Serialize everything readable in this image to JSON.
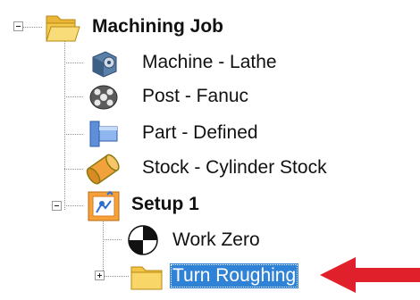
{
  "tree": {
    "root": {
      "label": "Machining Job",
      "icon": "open-folder-icon",
      "expanded": true
    },
    "children": [
      {
        "label": "Machine - Lathe",
        "icon": "machine-icon"
      },
      {
        "label": "Post - Fanuc",
        "icon": "post-reel-icon"
      },
      {
        "label": "Part - Defined",
        "icon": "part-icon"
      },
      {
        "label": "Stock - Cylinder Stock",
        "icon": "stock-cylinder-icon"
      }
    ],
    "setup": {
      "label": "Setup 1",
      "icon": "setup-icon",
      "expanded": true,
      "children": [
        {
          "label": "Work Zero",
          "icon": "work-zero-icon"
        },
        {
          "label": "Turn Roughing",
          "icon": "folder-icon",
          "selected": true,
          "collapsed": true
        }
      ]
    }
  },
  "annotation": {
    "arrow_color": "#e0202a",
    "arrow_icon": "red-arrow-left"
  },
  "colors": {
    "selection": "#2f82d6",
    "folder": "#f4c542"
  }
}
